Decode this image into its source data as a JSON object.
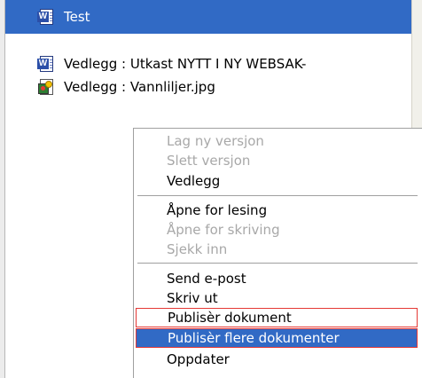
{
  "tree": {
    "selected": {
      "label": "Test",
      "icon": "word-document-icon"
    },
    "attachments": [
      {
        "label": "Vedlegg : Utkast NYTT I NY WEBSAK-",
        "icon": "word-document-icon"
      },
      {
        "label": "Vedlegg : Vannliljer.jpg",
        "icon": "image-file-icon"
      }
    ]
  },
  "context_menu": {
    "items": [
      {
        "label": "Lag ny versjon",
        "enabled": false
      },
      {
        "label": "Slett versjon",
        "enabled": false
      },
      {
        "label": "Vedlegg",
        "enabled": true
      },
      {
        "label": "Åpne for lesing",
        "enabled": true
      },
      {
        "label": "Åpne for skriving",
        "enabled": false
      },
      {
        "label": "Sjekk inn",
        "enabled": false
      },
      {
        "label": "Send e-post",
        "enabled": true
      },
      {
        "label": "Skriv ut",
        "enabled": true
      },
      {
        "label": "Publisèr dokument",
        "enabled": true,
        "highlight": "red-outline"
      },
      {
        "label": "Publisèr flere dokumenter",
        "enabled": true,
        "highlight": "selected"
      },
      {
        "label": "Oppdater",
        "enabled": true
      }
    ]
  },
  "colors": {
    "selection": "#316ac5",
    "highlight_outline": "#e53935",
    "disabled_text": "#a8a8a8"
  }
}
